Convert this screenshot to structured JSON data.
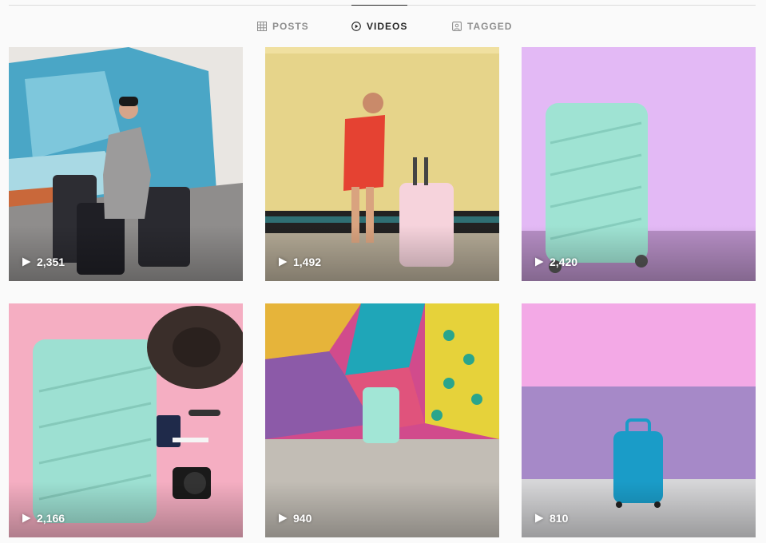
{
  "tabs": [
    {
      "label": "POSTS",
      "icon": "grid-icon",
      "active": false
    },
    {
      "label": "VIDEOS",
      "icon": "play-circle-icon",
      "active": true
    },
    {
      "label": "TAGGED",
      "icon": "tagged-icon",
      "active": false
    }
  ],
  "videos": [
    {
      "views": "2,351",
      "scene": "woman in grey coat with black luggage by mural",
      "background": "#9aa7b6"
    },
    {
      "views": "1,492",
      "scene": "woman in red dress with pink suitcase by yellow wall",
      "background": "#e8d88a"
    },
    {
      "views": "2,420",
      "scene": "mint suitcase on purple background",
      "background": "#e2b8f4"
    },
    {
      "views": "2,166",
      "scene": "mint suitcase flat lay with hat and camera on pink",
      "background": "#f4a9bf"
    },
    {
      "views": "940",
      "scene": "mint suitcase in front of colorful mural",
      "background": "#d94a8a"
    },
    {
      "views": "810",
      "scene": "blue carry-on bag against pink and lilac wall",
      "background": "#c58ad6"
    }
  ],
  "colors": {
    "active_tab": "#262626",
    "inactive_tab": "#8e8e8e",
    "divider": "#dbdbdb",
    "mint": "#9ee6d6"
  }
}
